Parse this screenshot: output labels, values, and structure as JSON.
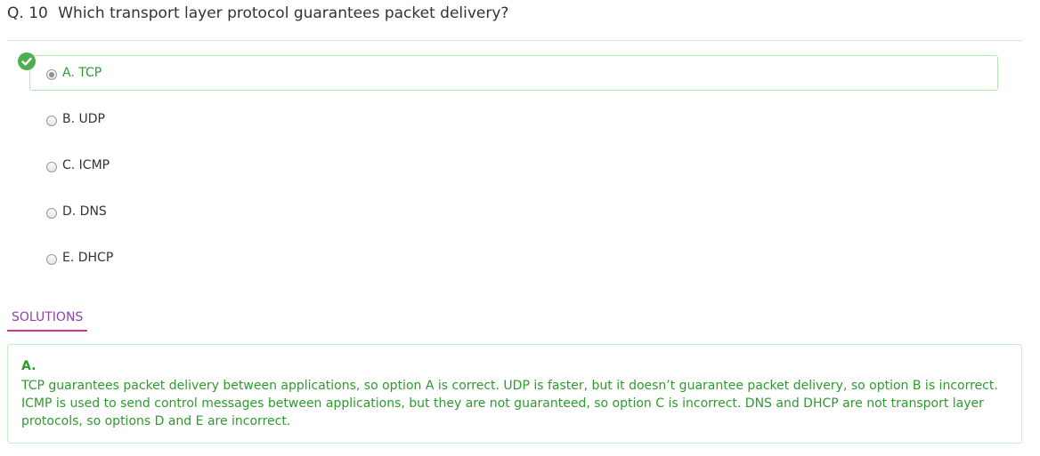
{
  "question": {
    "number": "Q. 10",
    "text": "Which transport layer protocol guarantees packet delivery?"
  },
  "options": [
    {
      "label": "A. TCP",
      "selected": true,
      "correct": true
    },
    {
      "label": "B. UDP",
      "selected": false,
      "correct": false
    },
    {
      "label": "C. ICMP",
      "selected": false,
      "correct": false
    },
    {
      "label": "D. DNS",
      "selected": false,
      "correct": false
    },
    {
      "label": "E. DHCP",
      "selected": false,
      "correct": false
    }
  ],
  "solutions": {
    "tab_label": "SOLUTIONS",
    "answer": "A.",
    "explanation": "TCP guarantees packet delivery between applications, so option A is correct. UDP is faster, but it doesn’t guarantee packet delivery, so option B is incorrect. ICMP is used to send control messages between applications, but they are not guaranteed, so option C is incorrect. DNS and DHCP are not transport layer protocols, so options D and E are incorrect."
  },
  "colors": {
    "correct_green": "#2e9a2e",
    "check_badge": "#4caf50",
    "solutions_tab_text": "#8e44ad",
    "solutions_tab_underline": "#d63384"
  },
  "icons": {
    "correct_marker": "check-circle-icon"
  }
}
